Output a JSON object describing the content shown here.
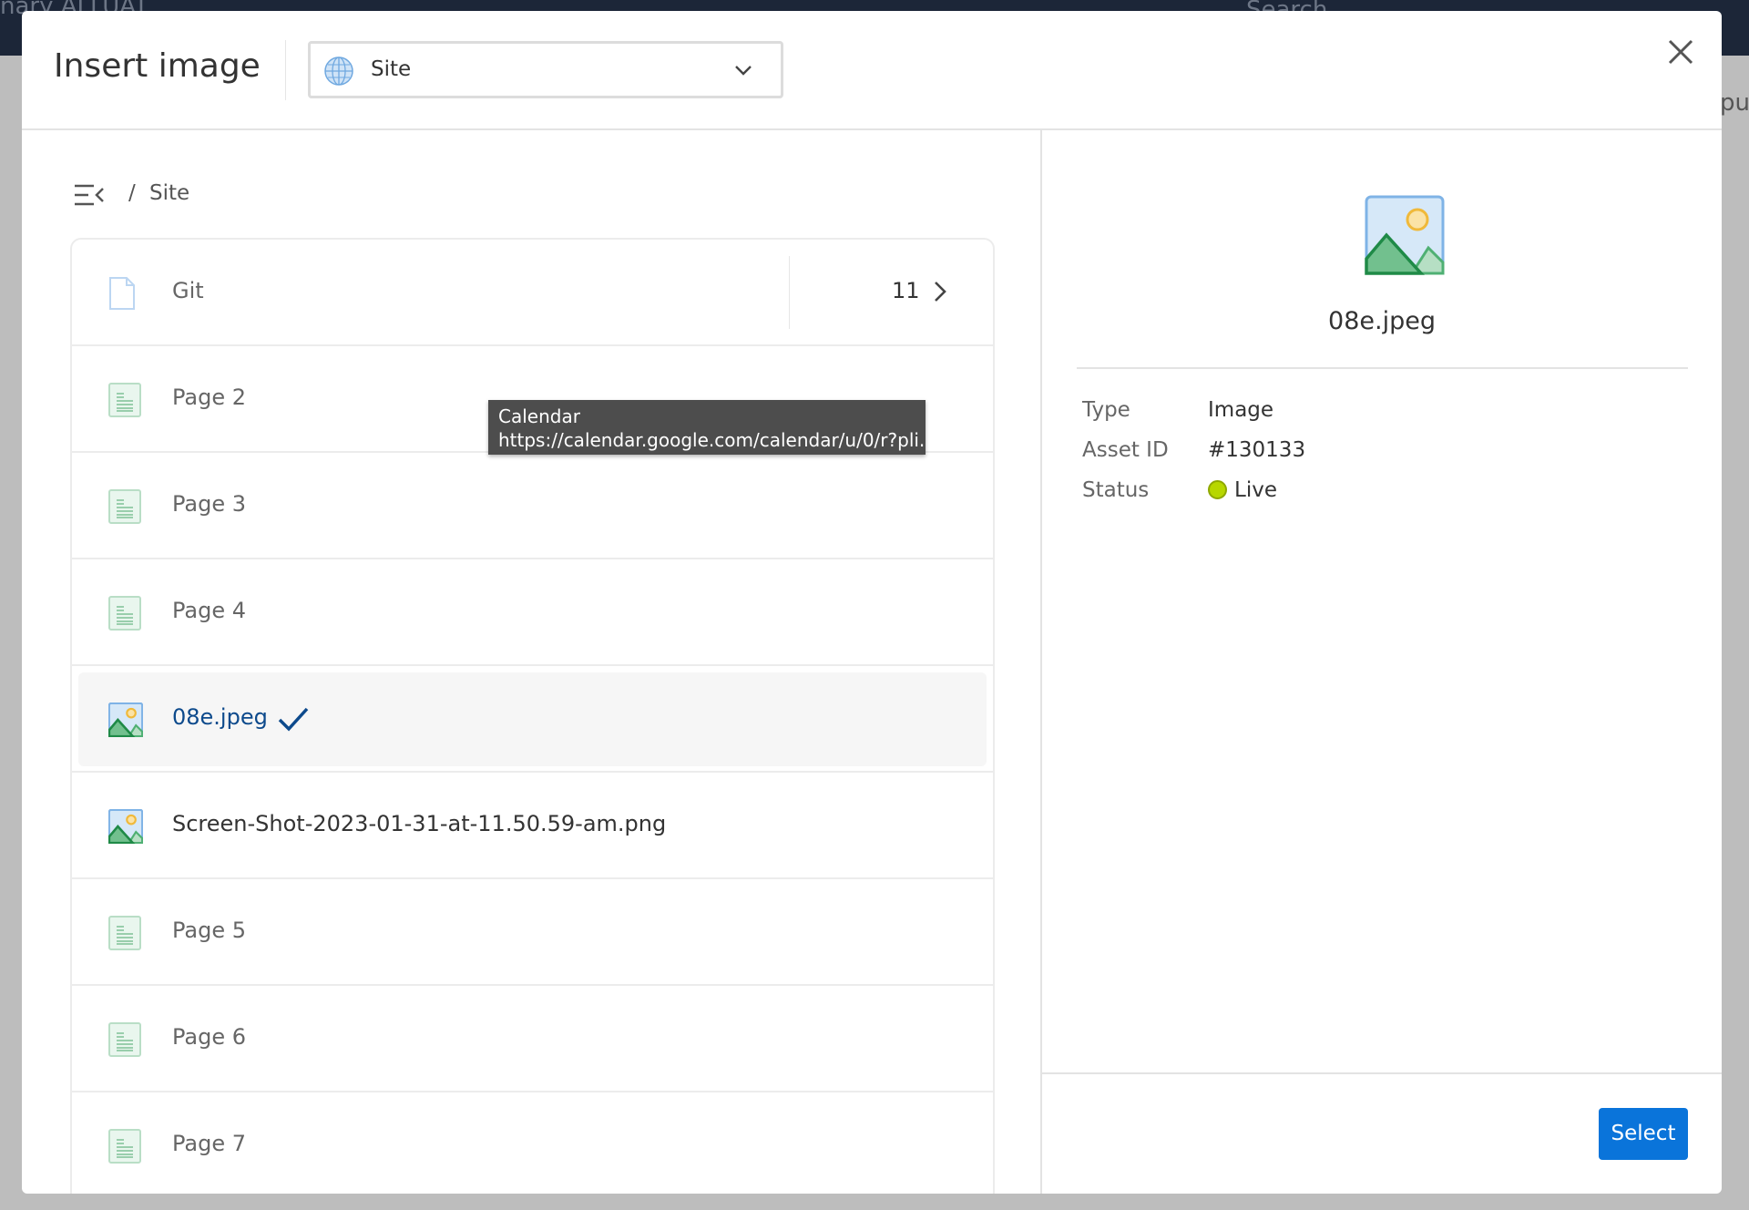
{
  "background": {
    "app_name": "nary ALLUAT",
    "search": "Search",
    "side_text": "pu"
  },
  "modal": {
    "title": "Insert image",
    "source_dropdown": {
      "value": "Site",
      "icon": "globe-icon"
    },
    "close_icon": "close-icon"
  },
  "breadcrumb": {
    "separator": "/",
    "current": "Site"
  },
  "list": [
    {
      "name": "Git",
      "type": "folder",
      "count": "11"
    },
    {
      "name": "Page 2",
      "type": "page"
    },
    {
      "name": "Page 3",
      "type": "page"
    },
    {
      "name": "Page 4",
      "type": "page"
    },
    {
      "name": "08e.jpeg",
      "type": "image",
      "selected": true
    },
    {
      "name": "Screen-Shot-2023-01-31-at-11.50.59-am.png",
      "type": "image"
    },
    {
      "name": "Page 5",
      "type": "page"
    },
    {
      "name": "Page 6",
      "type": "page"
    },
    {
      "name": "Page 7",
      "type": "page"
    }
  ],
  "tooltip": {
    "title": "Calendar",
    "url": "https://calendar.google.com/calendar/u/0/r?pli..."
  },
  "details": {
    "filename": "08e.jpeg",
    "type_label": "Type",
    "type_value": "Image",
    "asset_label": "Asset ID",
    "asset_value": "#130133",
    "status_label": "Status",
    "status_value": "Live",
    "status_color": "#b7d700"
  },
  "footer": {
    "select_label": "Select"
  },
  "colors": {
    "accent": "#0a74da",
    "selected_text": "#0d4a8c"
  }
}
